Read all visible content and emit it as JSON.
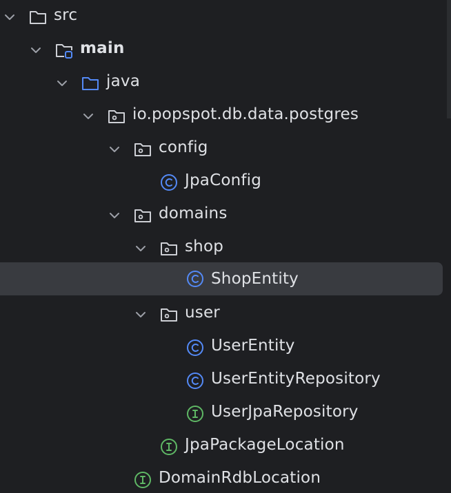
{
  "project_tree": {
    "nodes": [
      {
        "label": "src",
        "icon": "folder-icon",
        "expanded": true
      },
      {
        "label": "main",
        "icon": "source-folder-icon",
        "expanded": true
      },
      {
        "label": "java",
        "icon": "source-root-folder-icon",
        "expanded": true
      },
      {
        "label": "io.popspot.db.data.postgres",
        "icon": "package-icon",
        "expanded": true
      },
      {
        "label": "config",
        "icon": "package-icon",
        "expanded": true
      },
      {
        "label": "JpaConfig",
        "icon": "class-icon"
      },
      {
        "label": "domains",
        "icon": "package-icon",
        "expanded": true
      },
      {
        "label": "shop",
        "icon": "package-icon",
        "expanded": true
      },
      {
        "label": "ShopEntity",
        "icon": "class-icon",
        "selected": true
      },
      {
        "label": "user",
        "icon": "package-icon",
        "expanded": true
      },
      {
        "label": "UserEntity",
        "icon": "class-icon"
      },
      {
        "label": "UserEntityRepository",
        "icon": "class-icon"
      },
      {
        "label": "UserJpaRepository",
        "icon": "interface-icon"
      },
      {
        "label": "JpaPackageLocation",
        "icon": "interface-icon"
      },
      {
        "label": "DomainRdbLocation",
        "icon": "interface-icon"
      }
    ]
  },
  "colors": {
    "background": "#1e1f22",
    "selection": "#393b40",
    "text": "#dfe1e5",
    "chevron": "#9da0a8",
    "folder_outline": "#ced0d6",
    "source_folder_accent": "#548af7",
    "class_icon": "#548af7",
    "interface_icon": "#5fb865"
  }
}
